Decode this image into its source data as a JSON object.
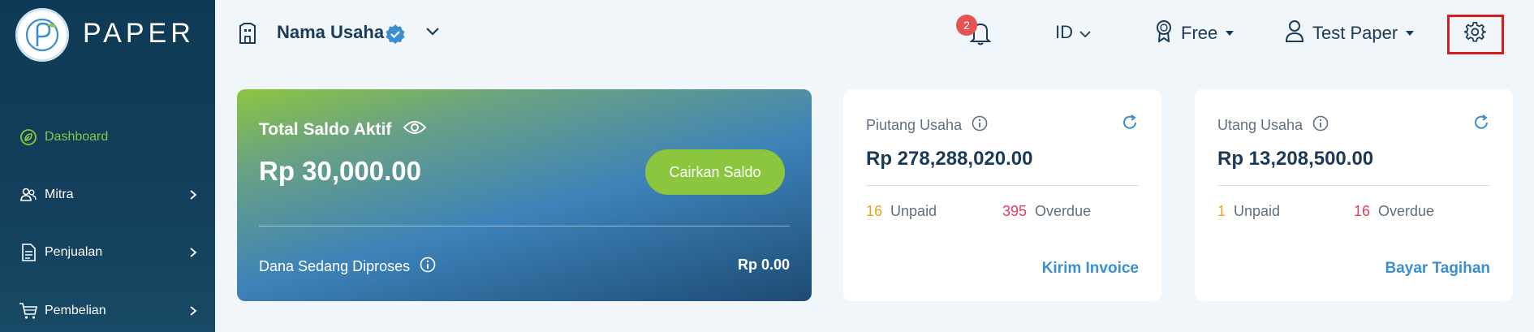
{
  "brand": {
    "name": "PAPER",
    "icon": "paper-logo"
  },
  "sidebar": {
    "items": [
      {
        "label": "Dashboard",
        "icon": "leaf-circle-icon",
        "active": true
      },
      {
        "label": "Mitra",
        "icon": "users-icon"
      },
      {
        "label": "Penjualan",
        "icon": "document-icon"
      },
      {
        "label": "Pembelian",
        "icon": "cart-icon"
      }
    ]
  },
  "header": {
    "business_name": "Nama Usaha",
    "notification_count": "2",
    "language": "ID",
    "plan": "Free",
    "user": "Test Paper"
  },
  "saldo": {
    "title": "Total Saldo Aktif",
    "amount": "Rp 30,000.00",
    "button": "Cairkan Saldo",
    "processing_label": "Dana Sedang Diproses",
    "processing_value": "Rp 0.00"
  },
  "piutang": {
    "title": "Piutang Usaha",
    "amount": "Rp 278,288,020.00",
    "unpaid_count": "16",
    "unpaid_label": "Unpaid",
    "overdue_count": "395",
    "overdue_label": "Overdue",
    "action": "Kirim Invoice"
  },
  "utang": {
    "title": "Utang Usaha",
    "amount": "Rp 13,208,500.00",
    "unpaid_count": "1",
    "unpaid_label": "Unpaid",
    "overdue_count": "16",
    "overdue_label": "Overdue",
    "action": "Bayar Tagihan"
  },
  "colors": {
    "sidebar_bg": "#0f3a55",
    "accent_green": "#8cc63f",
    "link_blue": "#3b8ed0",
    "highlight_red": "#d51f1f",
    "unpaid_yellow": "#f0a020",
    "overdue_red": "#e23d5e"
  }
}
